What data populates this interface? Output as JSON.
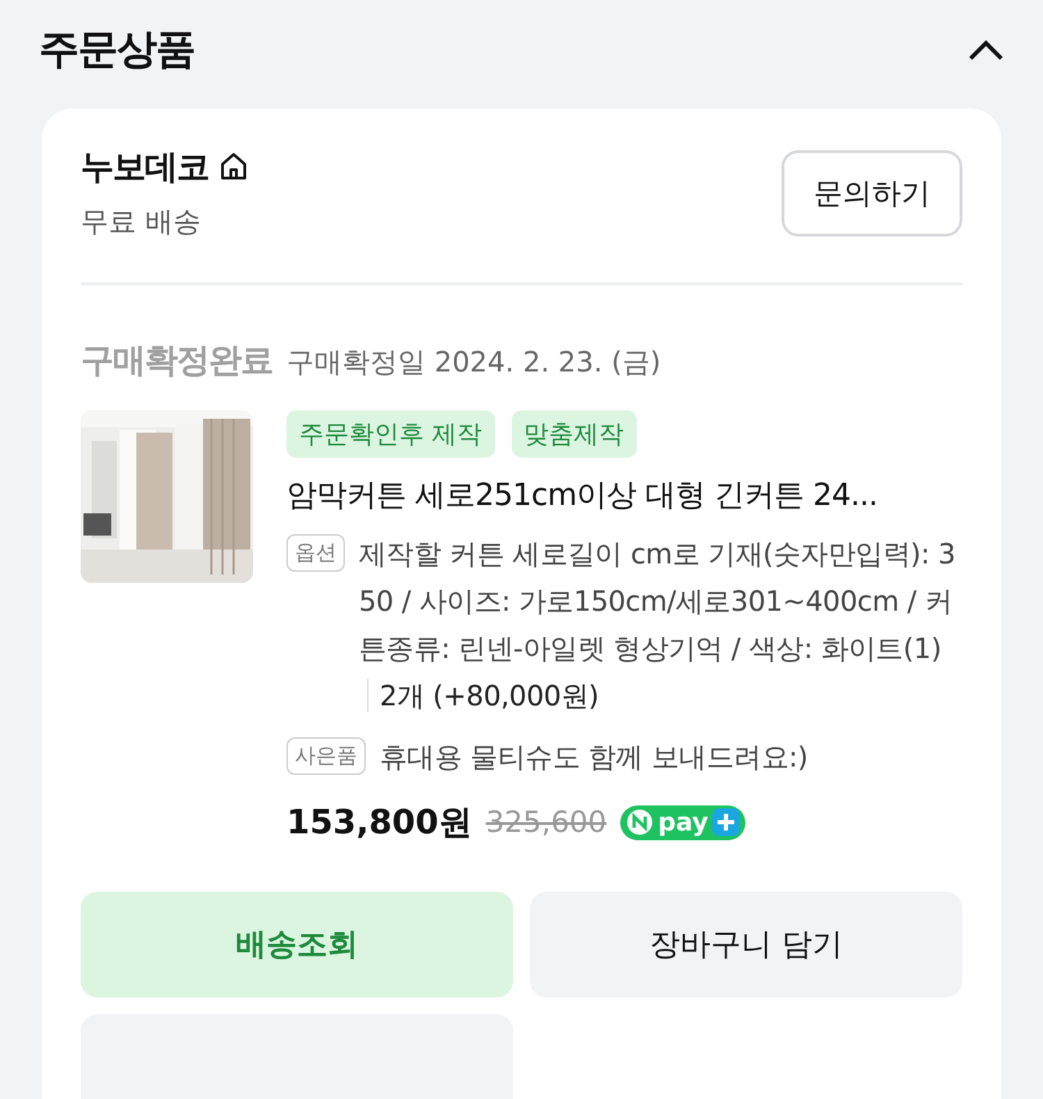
{
  "section": {
    "title": "주문상품",
    "expanded": true
  },
  "seller": {
    "name": "누보데코",
    "shipping": "무료 배송",
    "inquiry_button": "문의하기"
  },
  "order": {
    "status": "구매확정완료",
    "confirmed_date": "구매확정일 2024. 2. 23. (금)"
  },
  "product": {
    "image": {
      "kind": "picture"
    },
    "tags": [
      "주문확인후 제작",
      "맞춤제작"
    ],
    "title": "암막커튼 세로251cm이상 대형 긴커튼 24...",
    "option": {
      "label": "옵션",
      "text": "제작할 커튼 세로길이 cm로 기재(숫자만입력): 350 / 사이즈: 가로150cm/세로301~400cm / 커튼종류: 린넨-아일렛 형상기억 / 색상: 화이트(1)",
      "quantity": "2개 (+80,000원)"
    },
    "gift": {
      "label": "사은품",
      "text": "휴대용 물티슈도 함께 보내드려요:)"
    },
    "price": "153,800원",
    "original_price": "325,600",
    "pay_badge": "pay"
  },
  "buttons": [
    {
      "label": "배송조회",
      "kind": "primary"
    },
    {
      "label": "장바구니 담기",
      "kind": "secondary"
    },
    {
      "kind": "secondary"
    }
  ]
}
